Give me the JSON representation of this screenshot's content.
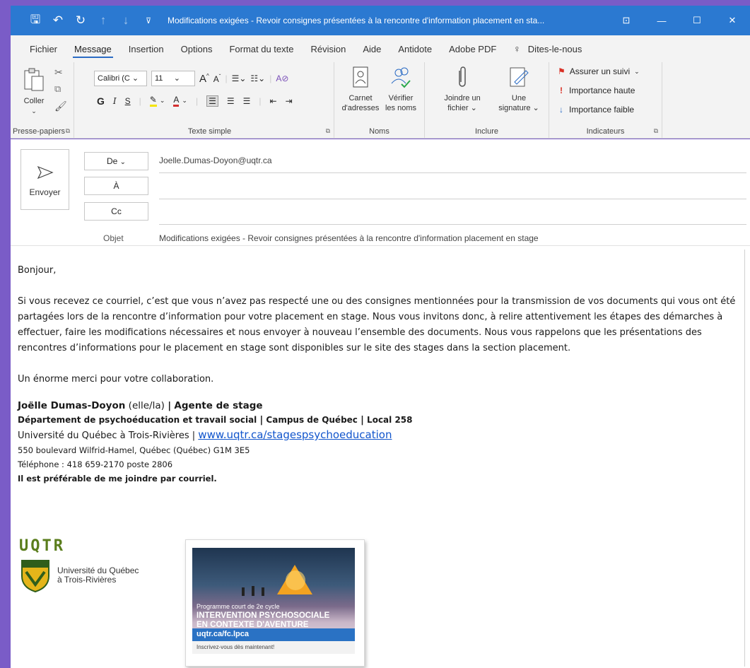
{
  "window": {
    "title": "Modifications exigées - Revoir consignes présentées à la rencontre d'information placement en sta...",
    "controls": [
      "⊡",
      "—",
      "☐",
      "✕"
    ]
  },
  "quick_access": {
    "icons": [
      "save-icon",
      "undo-icon",
      "redo-icon",
      "up-icon",
      "down-icon",
      "customize-icon"
    ]
  },
  "tabs": [
    "Fichier",
    "Message",
    "Insertion",
    "Options",
    "Format du texte",
    "Révision",
    "Aide",
    "Antidote",
    "Adobe PDF",
    "Dites-le-nous"
  ],
  "ribbon": {
    "clipboard": {
      "paste": "Coller",
      "label": "Presse-papiers"
    },
    "font": {
      "name": "Calibri (C",
      "size": "11",
      "bold": "G",
      "italic": "I",
      "underline": "S",
      "label": "Texte simple"
    },
    "names": {
      "address_book_1": "Carnet",
      "address_book_2": "d'adresses",
      "check_1": "Vérifier",
      "check_2": "les noms",
      "label": "Noms"
    },
    "include": {
      "attach_1": "Joindre un",
      "attach_2": "fichier",
      "signature_1": "Une",
      "signature_2": "signature",
      "label": "Inclure"
    },
    "tags": {
      "follow_up": "Assurer un suivi",
      "high": "Importance haute",
      "low": "Importance faible",
      "label": "Indicateurs"
    }
  },
  "header": {
    "send": "Envoyer",
    "from_btn": "De",
    "from_value": "Joelle.Dumas-Doyon@uqtr.ca",
    "to_btn": "À",
    "cc_btn": "Cc",
    "subject_label": "Objet",
    "subject_value": "Modifications exigées - Revoir consignes présentées à la rencontre d'information placement en stage"
  },
  "body": {
    "greeting": "Bonjour,",
    "paragraph": "Si vous recevez ce courriel, c’est que vous n’avez pas respecté une ou des consignes mentionnées pour la transmission de vos documents qui vous ont été partagées lors de la rencontre d’information pour votre placement en stage. Nous vous invitons donc, à relire attentivement les étapes des démarches à effectuer, faire les modifications nécessaires et nous envoyer à nouveau l’ensemble des documents. Nous vous rappelons que les présentations des rencontres d’informations pour le placement en stage sont disponibles sur le site des stages dans la section placement.",
    "thanks": "Un énorme merci pour votre collaboration."
  },
  "signature": {
    "name": "Joëlle Dumas-Doyon",
    "pronouns": "(elle/la)",
    "sep": "|",
    "role": "Agente de stage",
    "department": "Département de psychoéducation et travail social",
    "campus": "Campus de Québec",
    "local": "Local 258",
    "university": "Université du Québec à Trois-Rivières",
    "website": "www.uqtr.ca/stagespsychoeducation",
    "address": "550 boulevard Wilfrid-Hamel, Québec (Québec) G1M 3E5",
    "phone": "Téléphone : 418 659-2170 poste 2806",
    "note": "Il est préférable de me joindre par courriel."
  },
  "logo": {
    "acronym": "UQTR",
    "line1": "Université du Québec",
    "line2": "à Trois-Rivières"
  },
  "promo": {
    "line1": "Programme court de 2e cycle",
    "line2": "INTERVENTION PSYCHOSOCIALE",
    "line3": "EN CONTEXTE D'AVENTURE",
    "url": "uqtr.ca/fc.lpca",
    "cta": "Inscrivez-vous dès maintenant!"
  }
}
